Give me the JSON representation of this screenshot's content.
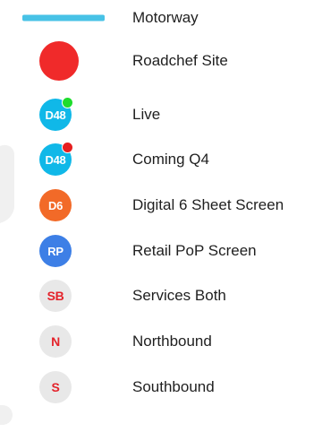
{
  "legend": {
    "items": [
      {
        "symbol_type": "line",
        "color": "#47c2e6",
        "label": "Motorway"
      },
      {
        "symbol_type": "dot",
        "color": "#f02a2a",
        "label": "Roadchef Site"
      },
      {
        "symbol_type": "badge",
        "badge_text": "D48",
        "color": "#10b8e8",
        "status_color": "#1edc2c",
        "label": "Live"
      },
      {
        "symbol_type": "badge",
        "badge_text": "D48",
        "color": "#10b8e8",
        "status_color": "#e61f1f",
        "label": "Coming Q4"
      },
      {
        "symbol_type": "badge",
        "badge_text": "D6",
        "color": "#f26a28",
        "label": "Digital 6 Sheet Screen"
      },
      {
        "symbol_type": "badge",
        "badge_text": "RP",
        "color": "#3d7fe6",
        "label": "Retail PoP Screen"
      },
      {
        "symbol_type": "badge",
        "badge_text": "SB",
        "color": "#e8e8e8",
        "text_color": "#e4232b",
        "label": "Services Both"
      },
      {
        "symbol_type": "badge",
        "badge_text": "N",
        "color": "#e8e8e8",
        "text_color": "#e4232b",
        "label": "Northbound"
      },
      {
        "symbol_type": "badge",
        "badge_text": "S",
        "color": "#e8e8e8",
        "text_color": "#e4232b",
        "label": "Southbound"
      }
    ]
  }
}
